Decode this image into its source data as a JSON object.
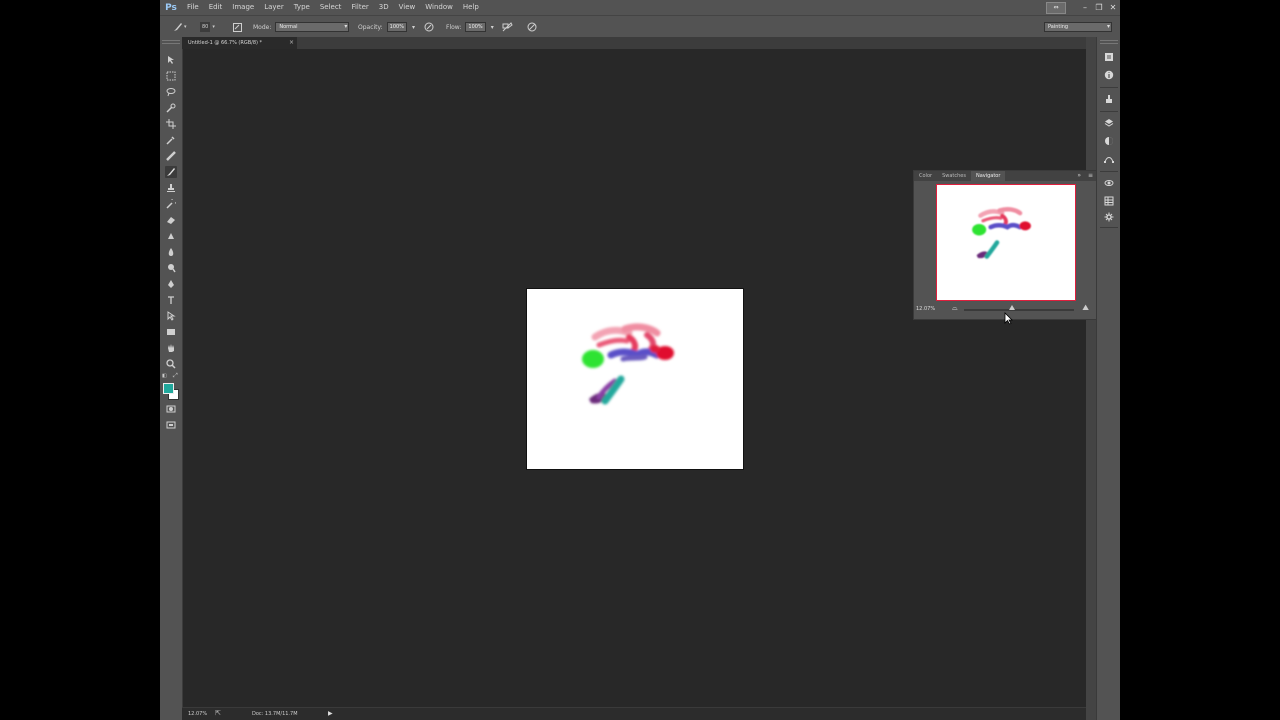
{
  "app": {
    "logo": "Ps",
    "menu": [
      "File",
      "Edit",
      "Image",
      "Layer",
      "Type",
      "Select",
      "Filter",
      "3D",
      "View",
      "Window",
      "Help"
    ],
    "window_controls": [
      "–",
      "❐",
      "✕"
    ],
    "workspace_preset": "Painting"
  },
  "options": {
    "mode_label": "Mode:",
    "mode_value": "Normal",
    "opacity_label": "Opacity:",
    "opacity_value": "100%",
    "flow_label": "Flow:",
    "flow_value": "100%",
    "brush_size": "80"
  },
  "document": {
    "tab_title": "Untitled-1 @ 66.7% (RGB/8) *",
    "close_glyph": "×"
  },
  "tools": [
    "move-icon",
    "marquee-icon",
    "lasso-icon",
    "quick-select-icon",
    "crop-icon",
    "eyedropper-icon",
    "healing-brush-icon",
    "brush-icon",
    "clone-stamp-icon",
    "history-brush-icon",
    "eraser-icon",
    "gradient-icon",
    "blur-icon",
    "dodge-icon",
    "pen-icon",
    "type-icon",
    "path-select-icon",
    "rectangle-icon",
    "hand-icon",
    "zoom-icon"
  ],
  "colors": {
    "foreground": "#21a89c",
    "background": "#ffffff",
    "canvas": "#ffffff",
    "nav_frame": "#e01e3c"
  },
  "navigator": {
    "tabs": [
      "Color",
      "Swatches",
      "Navigator"
    ],
    "active_tab": "Navigator",
    "zoom": "12.07%",
    "zoom_fraction": 0.44
  },
  "status": {
    "zoom": "12.07%",
    "doc": "Doc: 13.7M/11.7M"
  },
  "dock_icons": [
    "properties-icon",
    "info-icon",
    "brush-preset-icon",
    "layers-icon",
    "adjustments-icon",
    "paths-icon",
    "3d-icon",
    "channels-icon",
    "settings-icon"
  ]
}
